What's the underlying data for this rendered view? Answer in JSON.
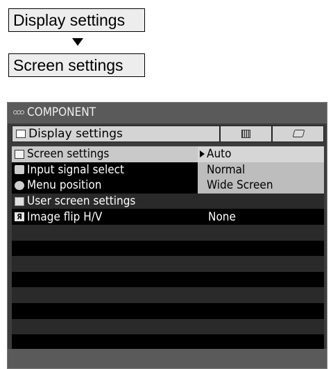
{
  "breadcrumb": {
    "parent": "Display settings",
    "current": "Screen settings"
  },
  "osd": {
    "source": "COMPONENT",
    "active_tab": "Display settings",
    "menu_items": [
      {
        "label": "Screen settings",
        "value": "Auto",
        "icon": "screen-icon"
      },
      {
        "label": "Input signal select",
        "value": "",
        "icon": "plug-icon"
      },
      {
        "label": "Menu position",
        "value": "",
        "icon": "menu-position-icon"
      },
      {
        "label": "User screen settings",
        "value": "",
        "icon": "user-screen-icon"
      },
      {
        "label": "Image flip H/V",
        "value": "None",
        "icon": "flip-icon"
      }
    ],
    "options": [
      "Auto",
      "Normal",
      "Wide Screen"
    ],
    "selected_option": "Auto",
    "flip_glyph": "Я"
  },
  "colors": {
    "panel": "#3c3c3c",
    "highlight": "#c9c9c9",
    "row_dark": "#000000",
    "row_alt": "#2a2a2a"
  }
}
